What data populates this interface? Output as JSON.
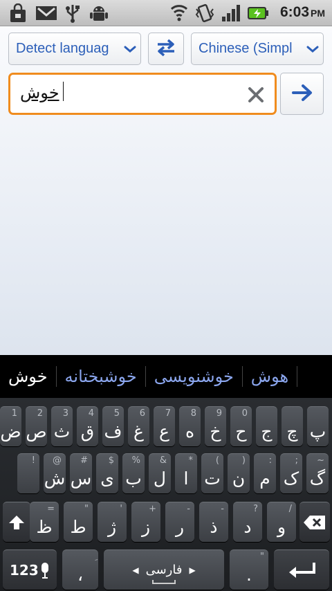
{
  "status_bar": {
    "time": "6:03",
    "ampm": "PM",
    "icons": [
      "shopping-bag-icon",
      "gmail-icon",
      "usb-icon",
      "android-debug-icon",
      "wifi-icon",
      "vibrate-icon",
      "signal-icon",
      "battery-charging-icon"
    ],
    "colors": {
      "battery": "#5ac11f"
    }
  },
  "translator": {
    "source_language": "Detect languag",
    "target_language": "Chinese (Simpl",
    "input_value": "خوش",
    "colors": {
      "accent": "#2c5fb9",
      "focus_border": "#f08c1e"
    }
  },
  "suggestions": {
    "items": [
      "خوش",
      "خوشبختانه",
      "خوشنویسی",
      "هوش"
    ],
    "primary_index": 0
  },
  "keyboard": {
    "row1": [
      {
        "main": "پ",
        "hint": ""
      },
      {
        "main": "چ",
        "hint": ""
      },
      {
        "main": "ج",
        "hint": ""
      },
      {
        "main": "ح",
        "hint": "0"
      },
      {
        "main": "خ",
        "hint": "9"
      },
      {
        "main": "ه",
        "hint": "8"
      },
      {
        "main": "ع",
        "hint": "7"
      },
      {
        "main": "غ",
        "hint": "6"
      },
      {
        "main": "ف",
        "hint": "5"
      },
      {
        "main": "ق",
        "hint": "4"
      },
      {
        "main": "ث",
        "hint": "3"
      },
      {
        "main": "ص",
        "hint": "2"
      },
      {
        "main": "ض",
        "hint": "1"
      }
    ],
    "row2": [
      {
        "main": "گ",
        "hint": "~"
      },
      {
        "main": "ک",
        "hint": ";"
      },
      {
        "main": "م",
        "hint": ":"
      },
      {
        "main": "ن",
        "hint": ")"
      },
      {
        "main": "ت",
        "hint": "("
      },
      {
        "main": "ا",
        "hint": "*"
      },
      {
        "main": "ل",
        "hint": "&"
      },
      {
        "main": "ب",
        "hint": "%"
      },
      {
        "main": "ی",
        "hint": "$"
      },
      {
        "main": "س",
        "hint": "#"
      },
      {
        "main": "ش",
        "hint": "@"
      },
      {
        "main": "",
        "hint": "!"
      }
    ],
    "row3": [
      {
        "main": "و",
        "hint": "/"
      },
      {
        "main": "د",
        "hint": "?"
      },
      {
        "main": "ذ",
        "hint": "-"
      },
      {
        "main": "ر",
        "hint": "-"
      },
      {
        "main": "ز",
        "hint": "+"
      },
      {
        "main": "ژ",
        "hint": "'"
      },
      {
        "main": "ط",
        "hint": "\""
      },
      {
        "main": "ظ",
        "hint": "="
      }
    ],
    "row4": {
      "numbers_label": "123",
      "comma_label": "،",
      "comma_hint": "ِ",
      "space_label": "فارسی",
      "period_label": ".",
      "period_hint": "\""
    }
  }
}
